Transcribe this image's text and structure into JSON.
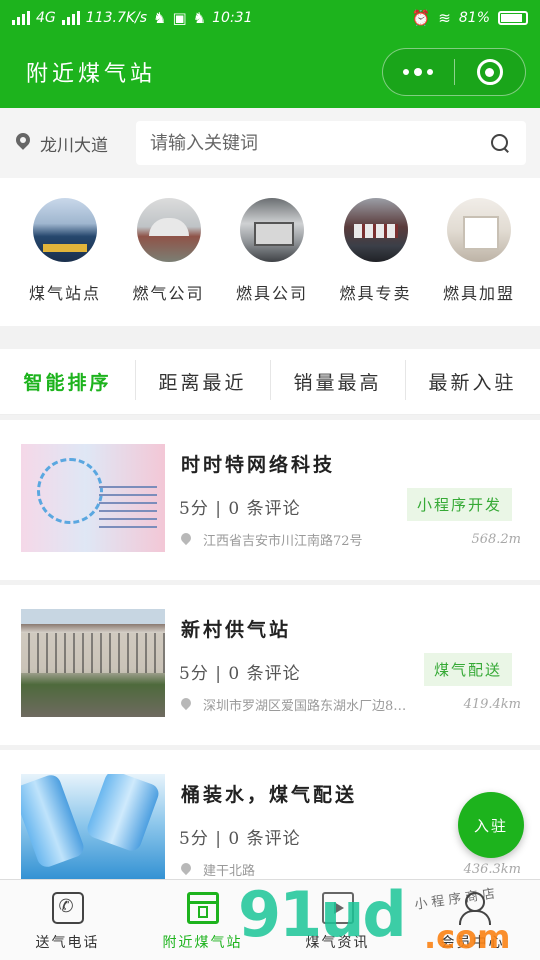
{
  "status_bar": {
    "network": "4G",
    "speed": "113.7K/s",
    "time": "10:31",
    "battery": "81%"
  },
  "navbar": {
    "title": "附近煤气站"
  },
  "search": {
    "location": "龙川大道",
    "placeholder": "请输入关键词"
  },
  "categories": [
    {
      "label": "煤气站点"
    },
    {
      "label": "燃气公司"
    },
    {
      "label": "燃具公司"
    },
    {
      "label": "燃具专卖"
    },
    {
      "label": "燃具加盟"
    }
  ],
  "sort_tabs": [
    {
      "label": "智能排序"
    },
    {
      "label": "距离最近"
    },
    {
      "label": "销量最高"
    },
    {
      "label": "最新入驻"
    }
  ],
  "listings": [
    {
      "name": "时时特网络科技",
      "score": "5分",
      "sep": "|",
      "reviews": "0",
      "reviews_suffix": "条评论",
      "tag": "小程序开发",
      "address": "江西省吉安市川江南路72号",
      "distance": "568.2m"
    },
    {
      "name": "新村供气站",
      "score": "5分",
      "sep": "|",
      "reviews": "0",
      "reviews_suffix": "条评论",
      "tag": "煤气配送",
      "address": "深圳市罗湖区爱国路东湖水厂边8…",
      "distance": "419.4km"
    },
    {
      "name": "桶装水，煤气配送",
      "score": "5分",
      "sep": "|",
      "reviews": "0",
      "reviews_suffix": "条评论",
      "tag": "",
      "address": "建干北路",
      "distance": "436.3km"
    }
  ],
  "fab": {
    "label": "入驻"
  },
  "tabbar": [
    {
      "label": "送气电话",
      "icon": "phone-icon"
    },
    {
      "label": "附近煤气站",
      "icon": "store-icon"
    },
    {
      "label": "煤气资讯",
      "icon": "news-icon"
    },
    {
      "label": "会员中心",
      "icon": "user-icon"
    }
  ],
  "watermark": {
    "main": "91ud",
    "domain": ".com",
    "text": "小程序商店"
  },
  "colors": {
    "accent": "#1db31d",
    "tag_bg": "#eaf6e6"
  }
}
